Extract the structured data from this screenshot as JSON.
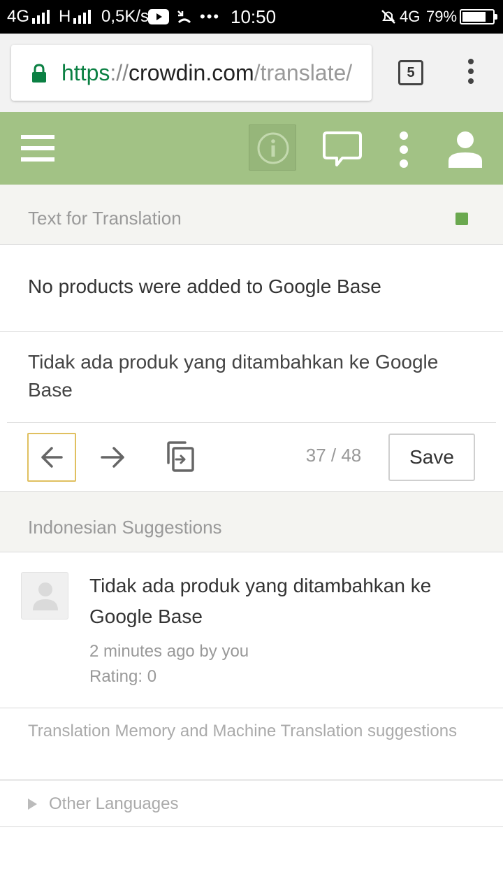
{
  "status_bar": {
    "network_left": "4G",
    "network_mid": "H",
    "speed": "0,5K/s",
    "time": "10:50",
    "network_right": "4G",
    "battery_percent": "79%",
    "battery_level": 0.79
  },
  "browser": {
    "url_scheme": "https",
    "url_sep": "://",
    "url_domain": "crowdin.com",
    "url_path": "/translate/",
    "tab_count": "5"
  },
  "toolbar": {
    "icons": [
      "menu-icon",
      "info-icon",
      "comment-icon",
      "more-vert-icon",
      "user-icon"
    ],
    "accent_color": "#a2c285"
  },
  "text_section": {
    "header": "Text for Translation",
    "status_color": "#6aa84f",
    "source_text": "No products were added to Google Base",
    "translation_text": "Tidak ada produk yang ditambahkan ke Google Base"
  },
  "editor_actions": {
    "counter": "37 / 48",
    "save_label": "Save"
  },
  "suggestions": {
    "header": "Indonesian Suggestions",
    "items": [
      {
        "text": "Tidak ada produk yang ditambahkan ke Google Base",
        "time_author": "2 minutes ago by you",
        "rating": "Rating: 0"
      }
    ]
  },
  "tm_mt": {
    "label": "Translation Memory and Machine Translation suggestions"
  },
  "other_languages": {
    "label": "Other Languages"
  }
}
